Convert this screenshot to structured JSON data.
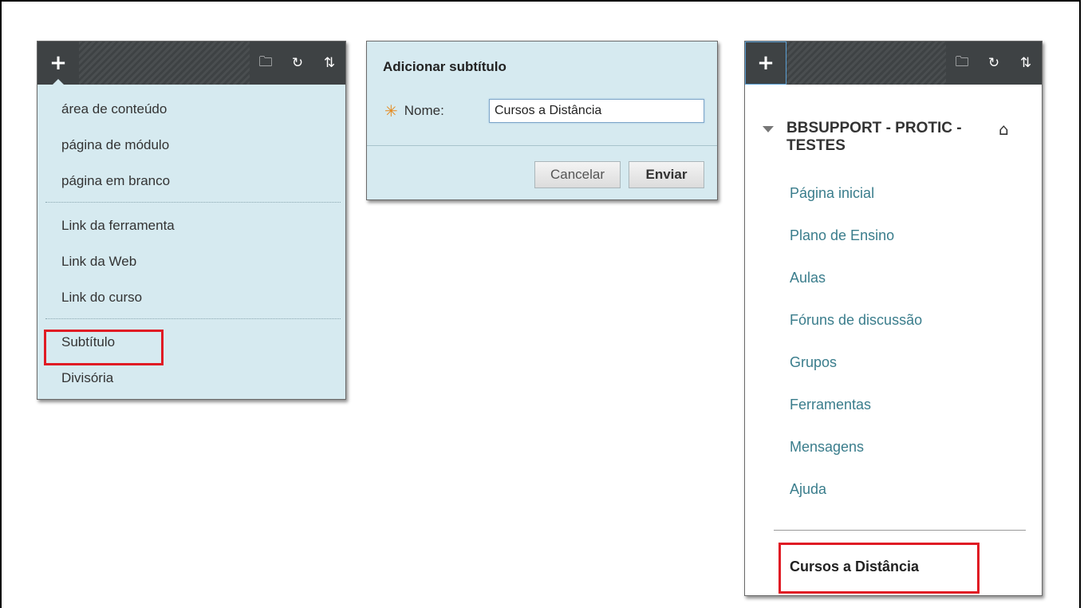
{
  "toolbar": {
    "plus_icon": "plus-icon",
    "folder_icon": "folder-icon",
    "refresh_icon": "refresh-icon",
    "sort_icon": "sort-icon",
    "plus": "+",
    "folder": "🗀",
    "refresh": "↻",
    "sort": "⇅"
  },
  "add_menu": {
    "items": [
      {
        "label": "área de conteúdo"
      },
      {
        "label": "página de módulo"
      },
      {
        "label": "página em branco"
      },
      {
        "label": "Link da ferramenta"
      },
      {
        "label": "Link da Web"
      },
      {
        "label": "Link do curso"
      },
      {
        "label": "Subtítulo"
      },
      {
        "label": "Divisória"
      }
    ]
  },
  "dialog": {
    "title": "Adicionar subtítulo",
    "required_mark": "✳",
    "name_label": "Nome:",
    "name_value": "Cursos a Distância",
    "cancel_label": "Cancelar",
    "submit_label": "Enviar"
  },
  "course_menu": {
    "course_name": "BBSUPPORT - PROTIC - TESTES",
    "home_icon": "⌂",
    "items": [
      {
        "label": "Página inicial"
      },
      {
        "label": "Plano de Ensino"
      },
      {
        "label": "Aulas"
      },
      {
        "label": "Fóruns de discussão"
      },
      {
        "label": "Grupos"
      },
      {
        "label": "Ferramentas"
      },
      {
        "label": "Mensagens"
      },
      {
        "label": "Ajuda"
      }
    ],
    "subtitle_entry": "Cursos a Distância"
  },
  "colors": {
    "toolbar_bg": "#3e4244",
    "panel_bg": "#d6eaf0",
    "highlight": "#e01b24",
    "link": "#3a7d8c"
  }
}
